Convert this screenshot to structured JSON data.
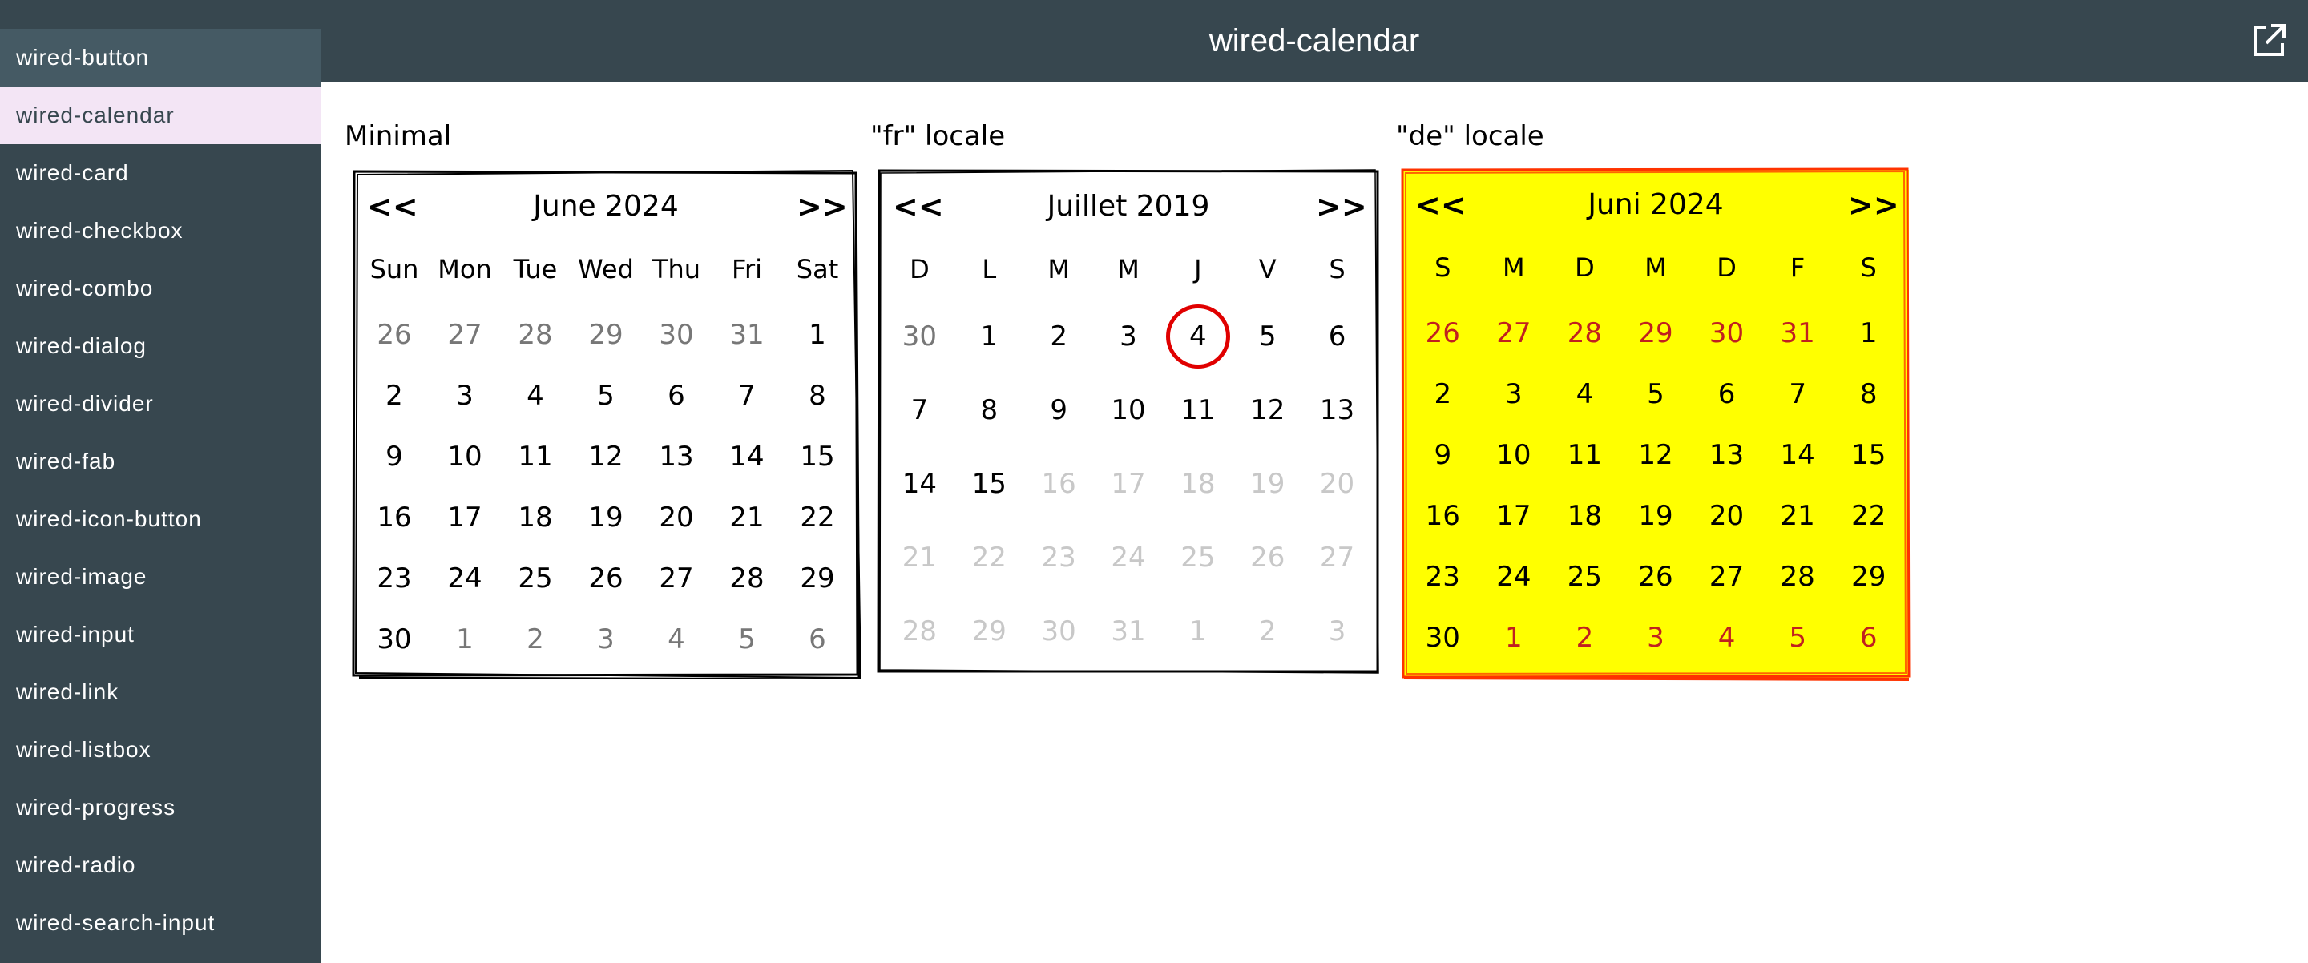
{
  "sidebar": {
    "items": [
      {
        "label": "wired-button"
      },
      {
        "label": "wired-calendar"
      },
      {
        "label": "wired-card"
      },
      {
        "label": "wired-checkbox"
      },
      {
        "label": "wired-combo"
      },
      {
        "label": "wired-dialog"
      },
      {
        "label": "wired-divider"
      },
      {
        "label": "wired-fab"
      },
      {
        "label": "wired-icon-button"
      },
      {
        "label": "wired-image"
      },
      {
        "label": "wired-input"
      },
      {
        "label": "wired-link"
      },
      {
        "label": "wired-listbox"
      },
      {
        "label": "wired-progress"
      },
      {
        "label": "wired-radio"
      },
      {
        "label": "wired-search-input"
      }
    ],
    "selected": "wired-calendar"
  },
  "header": {
    "title": "wired-calendar",
    "icon": "external-link-icon"
  },
  "demos": [
    {
      "label": "Minimal",
      "prev": "<<",
      "next": ">>",
      "month": "June 2024",
      "weekdays": [
        "Sun",
        "Mon",
        "Tue",
        "Wed",
        "Thu",
        "Fri",
        "Sat"
      ],
      "weeks": [
        [
          "26",
          "27",
          "28",
          "29",
          "30",
          "31",
          "1"
        ],
        [
          "2",
          "3",
          "4",
          "5",
          "6",
          "7",
          "8"
        ],
        [
          "9",
          "10",
          "11",
          "12",
          "13",
          "14",
          "15"
        ],
        [
          "16",
          "17",
          "18",
          "19",
          "20",
          "21",
          "22"
        ],
        [
          "23",
          "24",
          "25",
          "26",
          "27",
          "28",
          "29"
        ],
        [
          "30",
          "1",
          "2",
          "3",
          "4",
          "5",
          "6"
        ]
      ],
      "colors": {
        "background": "#ffffff",
        "border": "#000000",
        "outside_month": "#777777"
      }
    },
    {
      "label": "\"fr\" locale",
      "prev": "<<",
      "next": ">>",
      "month": "Juillet 2019",
      "weekdays": [
        "D",
        "L",
        "M",
        "M",
        "J",
        "V",
        "S"
      ],
      "weeks": [
        [
          "30",
          "1",
          "2",
          "3",
          "4",
          "5",
          "6"
        ],
        [
          "7",
          "8",
          "9",
          "10",
          "11",
          "12",
          "13"
        ],
        [
          "14",
          "15",
          "16",
          "17",
          "18",
          "19",
          "20"
        ],
        [
          "21",
          "22",
          "23",
          "24",
          "25",
          "26",
          "27"
        ],
        [
          "28",
          "29",
          "30",
          "31",
          "1",
          "2",
          "3"
        ]
      ],
      "selected_day": "4",
      "colors": {
        "background": "#ffffff",
        "border": "#000000",
        "selected_circle": "#e00000",
        "disabled": "#c8c8c8"
      }
    },
    {
      "label": "\"de\" locale",
      "prev": "<<",
      "next": ">>",
      "month": "Juni 2024",
      "weekdays": [
        "S",
        "M",
        "D",
        "M",
        "D",
        "F",
        "S"
      ],
      "weeks": [
        [
          "26",
          "27",
          "28",
          "29",
          "30",
          "31",
          "1"
        ],
        [
          "2",
          "3",
          "4",
          "5",
          "6",
          "7",
          "8"
        ],
        [
          "9",
          "10",
          "11",
          "12",
          "13",
          "14",
          "15"
        ],
        [
          "16",
          "17",
          "18",
          "19",
          "20",
          "21",
          "22"
        ],
        [
          "23",
          "24",
          "25",
          "26",
          "27",
          "28",
          "29"
        ],
        [
          "30",
          "1",
          "2",
          "3",
          "4",
          "5",
          "6"
        ]
      ],
      "colors": {
        "background": "#ffff00",
        "border": "#ff3300",
        "outside_month": "#c02020"
      }
    }
  ]
}
